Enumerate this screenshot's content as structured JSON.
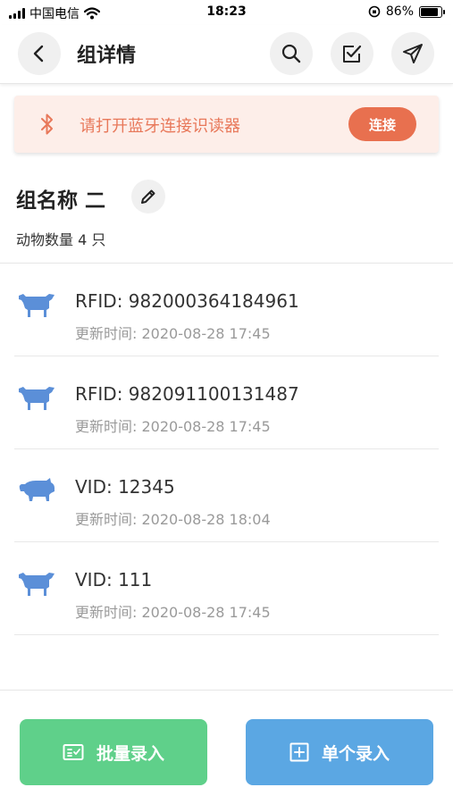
{
  "status_bar": {
    "carrier": "中国电信",
    "time": "18:23",
    "battery_percent": "86%",
    "battery_level": 0.86
  },
  "header": {
    "title": "组详情",
    "icons": [
      "back-icon",
      "search-icon",
      "checkbox-icon",
      "send-icon"
    ]
  },
  "bluetooth_banner": {
    "message": "请打开蓝牙连接识读器",
    "connect_label": "连接",
    "colors": {
      "background": "#fdeee9",
      "text": "#e8785a",
      "button": "#e8704f"
    }
  },
  "group": {
    "name": "组名称 二",
    "count_text": "动物数量 4 只"
  },
  "animals": [
    {
      "type": "cow-icon",
      "id": "RFID: 982000364184961",
      "updated": "更新时间: 2020-08-28 17:45"
    },
    {
      "type": "cow-icon",
      "id": "RFID: 982091100131487",
      "updated": "更新时间: 2020-08-28 17:45"
    },
    {
      "type": "pig-icon",
      "id": "VID: 12345",
      "updated": "更新时间: 2020-08-28 18:04"
    },
    {
      "type": "cow-icon",
      "id": "VID: 111",
      "updated": "更新时间: 2020-08-28 17:45"
    }
  ],
  "bottom": {
    "batch_label": "批量录入",
    "single_label": "单个录入",
    "colors": {
      "batch": "#5fd08a",
      "single": "#5ba7e3"
    }
  },
  "colors": {
    "animal_icon": "#5b8fd8"
  }
}
